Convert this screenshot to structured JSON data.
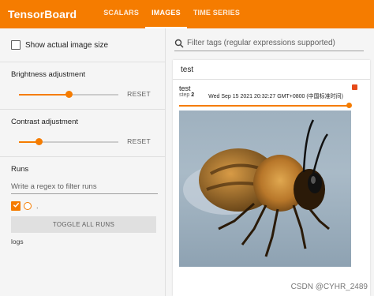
{
  "app": {
    "title": "TensorBoard"
  },
  "tabs": [
    {
      "label": "SCALARS",
      "active": false
    },
    {
      "label": "IMAGES",
      "active": true
    },
    {
      "label": "TIME SERIES",
      "active": false
    }
  ],
  "sidebar": {
    "show_actual_size_label": "Show actual image size",
    "show_actual_size_checked": false,
    "brightness": {
      "title": "Brightness adjustment",
      "value": 0.5,
      "reset_label": "RESET"
    },
    "contrast": {
      "title": "Contrast adjustment",
      "value": 0.2,
      "reset_label": "RESET"
    },
    "runs": {
      "title": "Runs",
      "regex_placeholder": "Write a regex to filter runs",
      "run_item_label": ".",
      "toggle_label": "TOGGLE ALL RUNS",
      "logdir": "logs"
    }
  },
  "main": {
    "filter_placeholder": "Filter tags (regular expressions supported)",
    "card": {
      "header": "test",
      "tag": "test",
      "step_label": "step",
      "step_value": "2",
      "timestamp": "Wed Sep 15 2021 20:32:27 GMT+0800 (中国标准时间)"
    }
  },
  "watermark": "CSDN @CYHR_2489",
  "colors": {
    "accent": "#f57c00",
    "expand": "#e64a19"
  },
  "icons": [
    "search-icon",
    "check-icon",
    "expand-icon"
  ]
}
